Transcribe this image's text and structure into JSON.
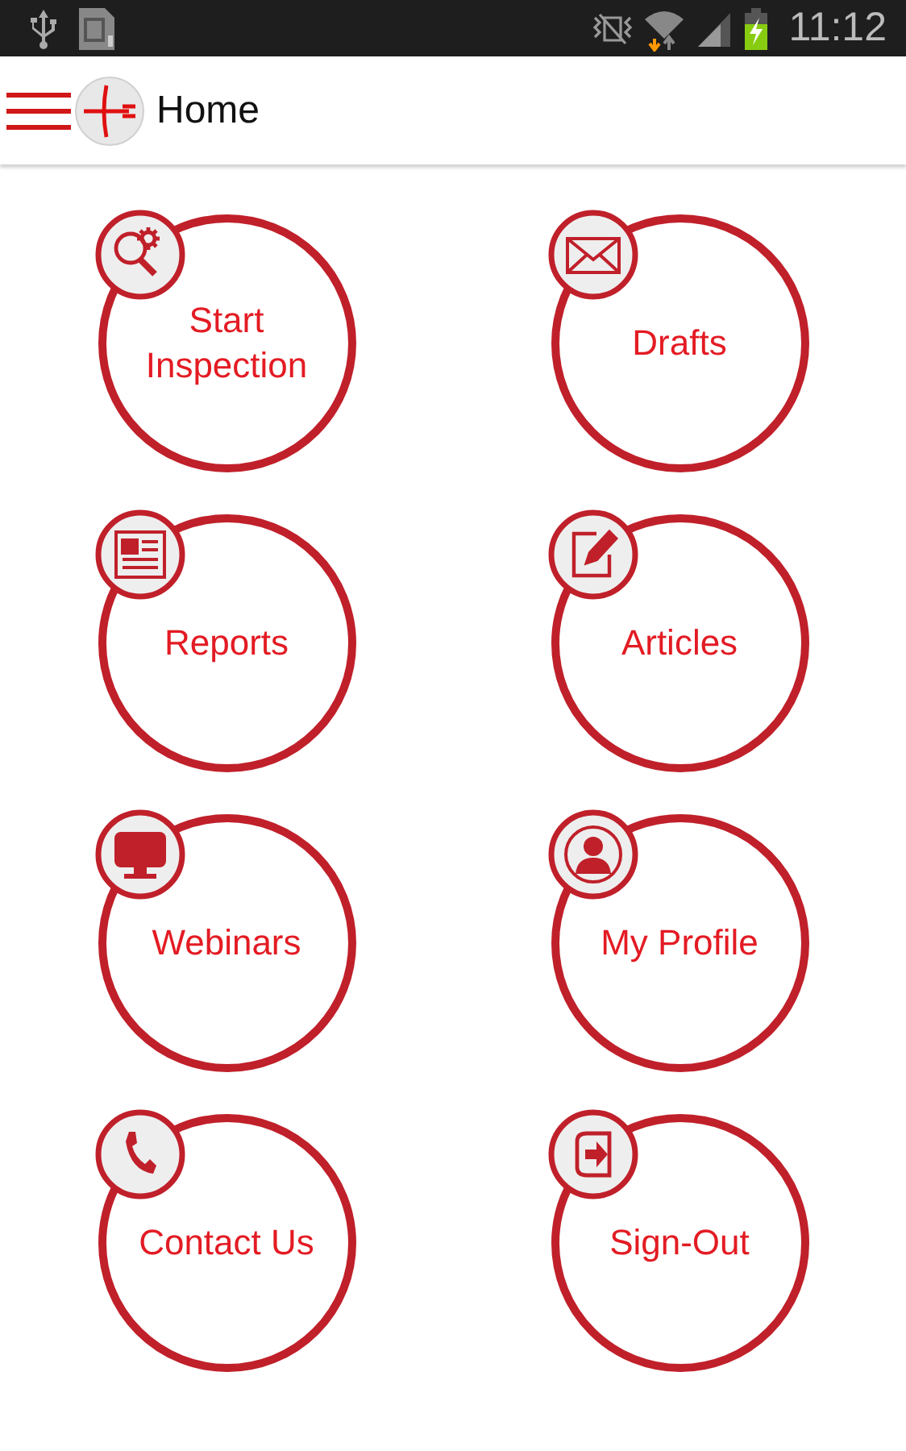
{
  "status_bar": {
    "time": "11:12"
  },
  "app_bar": {
    "title": "Home"
  },
  "tiles": [
    {
      "label": "Start Inspection",
      "kind": "inspect"
    },
    {
      "label": "Drafts",
      "kind": "mail"
    },
    {
      "label": "Reports",
      "kind": "report"
    },
    {
      "label": "Articles",
      "kind": "edit"
    },
    {
      "label": "Webinars",
      "kind": "monitor"
    },
    {
      "label": "My Profile",
      "kind": "profile"
    },
    {
      "label": "Contact Us",
      "kind": "phone"
    },
    {
      "label": "Sign-Out",
      "kind": "signout"
    }
  ]
}
